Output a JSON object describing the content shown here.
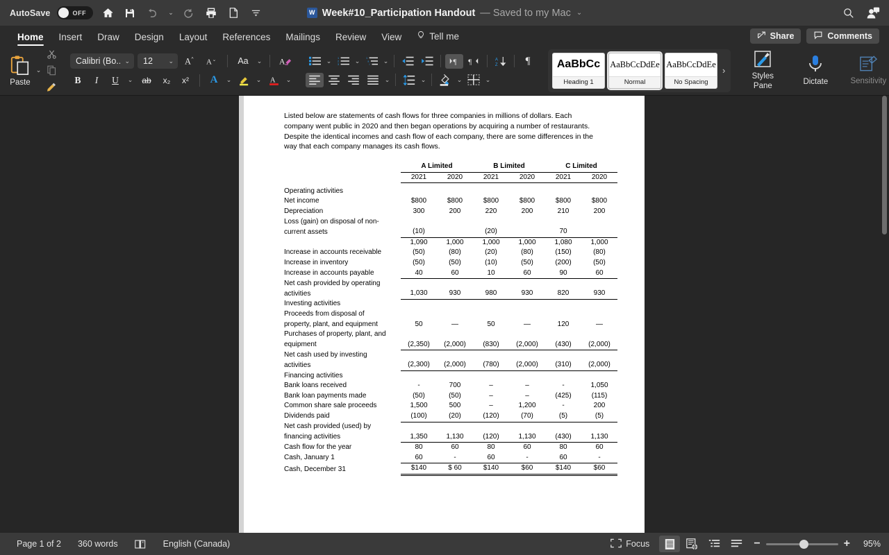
{
  "titlebar": {
    "autosave_label": "AutoSave",
    "autosave_state": "OFF",
    "doc_title": "Week#10_Participation Handout",
    "saved_status": "— Saved to my Mac",
    "quick_access": [
      {
        "name": "home-icon",
        "label": "Home"
      },
      {
        "name": "save-icon",
        "label": "Save"
      },
      {
        "name": "undo-icon",
        "label": "Undo"
      },
      {
        "name": "redo-icon",
        "label": "Redo"
      },
      {
        "name": "print-icon",
        "label": "Print"
      },
      {
        "name": "new-document-icon",
        "label": "New"
      },
      {
        "name": "customize-toolbar-icon",
        "label": "Customize Toolbar"
      }
    ],
    "search_icon": "search-icon",
    "account_icon": "account-icon"
  },
  "tabs": [
    {
      "label": "Home",
      "active": true
    },
    {
      "label": "Insert",
      "active": false
    },
    {
      "label": "Draw",
      "active": false
    },
    {
      "label": "Design",
      "active": false
    },
    {
      "label": "Layout",
      "active": false
    },
    {
      "label": "References",
      "active": false
    },
    {
      "label": "Mailings",
      "active": false
    },
    {
      "label": "Review",
      "active": false
    },
    {
      "label": "View",
      "active": false
    }
  ],
  "tellme": {
    "label": "Tell me",
    "icon": "lightbulb-icon"
  },
  "share_button": {
    "label": "Share",
    "icon": "share-icon"
  },
  "comments_button": {
    "label": "Comments",
    "icon": "comment-icon"
  },
  "ribbon": {
    "clipboard": {
      "paste_label": "Paste",
      "cut_icon": "scissors-icon",
      "copy_icon": "copy-icon",
      "format_painter_icon": "format-painter-icon"
    },
    "font": {
      "font_name": "Calibri (Bo...",
      "font_size": "12",
      "grow_font": "A^",
      "shrink_font": "Av",
      "change_case": "Aa",
      "clear_formatting": "clear-formatting-icon",
      "bold": "B",
      "italic": "I",
      "underline": "U",
      "strikethrough": "ab",
      "subscript": "x₂",
      "superscript": "x²",
      "text_effects": "A",
      "highlight": "A",
      "font_color": "A"
    },
    "paragraph": {
      "bullets": "bullets-icon",
      "numbering": "numbering-icon",
      "multilevel": "multilevel-list-icon",
      "decrease_indent": "decrease-indent-icon",
      "increase_indent": "increase-indent-icon",
      "ltr": "left-to-right-icon",
      "rtl": "right-to-left-icon",
      "sort": "sort-icon",
      "show_marks": "paragraph-marks-icon",
      "align_left": "align-left-icon",
      "align_center": "align-center-icon",
      "align_right": "align-right-icon",
      "justify": "justify-icon",
      "line_spacing": "line-spacing-icon",
      "shading": "shading-icon",
      "borders": "borders-icon"
    },
    "styles": [
      {
        "preview": "AaBbCc",
        "name": "Heading 1",
        "selected": false
      },
      {
        "preview": "AaBbCcDdEе",
        "name": "Normal",
        "selected": true
      },
      {
        "preview": "AaBbCcDdEе",
        "name": "No Spacing",
        "selected": false
      }
    ],
    "styles_more": "›",
    "styles_pane": {
      "line1": "Styles",
      "line2": "Pane",
      "icon": "styles-pane-icon"
    },
    "dictate": {
      "label": "Dictate",
      "icon": "microphone-icon"
    },
    "sensitivity": {
      "label": "Sensitivity",
      "icon": "sensitivity-icon"
    }
  },
  "document": {
    "intro": "Listed below are statements of cash flows for three companies in millions of dollars.  Each company went public in 2020 and then began operations by acquiring a number of restaurants. Despite the identical incomes and cash flow of each company, there are some differences in the way that each company manages its cash flows.",
    "companies": [
      "A Limited",
      "B Limited",
      "C Limited"
    ],
    "years": [
      "2021",
      "2020",
      "2021",
      "2020",
      "2021",
      "2020"
    ],
    "rows": [
      {
        "label": "Operating activities",
        "indent": 0,
        "values": [
          "",
          "",
          "",
          "",
          "",
          ""
        ]
      },
      {
        "label": "Net income",
        "indent": 1,
        "values": [
          "$800",
          "$800",
          "$800",
          "$800",
          "$800",
          "$800"
        ]
      },
      {
        "label": "Depreciation",
        "indent": 1,
        "values": [
          "300",
          "200",
          "220",
          "200",
          "210",
          "200"
        ]
      },
      {
        "label": "Loss (gain) on disposal of non-",
        "indent": 1,
        "values": [
          "",
          "",
          "",
          "",
          "",
          ""
        ]
      },
      {
        "label": "current assets",
        "indent": 2,
        "values": [
          "(10)",
          "",
          "(20)",
          "",
          "70",
          ""
        ],
        "rule_below": true
      },
      {
        "label": "",
        "indent": 0,
        "values": [
          "1,090",
          "1,000",
          "1,000",
          "1,000",
          "1,080",
          "1,000"
        ]
      },
      {
        "label": "Increase in accounts receivable",
        "indent": 2,
        "values": [
          "(50)",
          "(80)",
          "(20)",
          "(80)",
          "(150)",
          "(80)"
        ]
      },
      {
        "label": "Increase in inventory",
        "indent": 2,
        "values": [
          "(50)",
          "(50)",
          "(10)",
          "(50)",
          "(200)",
          "(50)"
        ]
      },
      {
        "label": "Increase in accounts payable",
        "indent": 2,
        "values": [
          "40",
          "60",
          "10",
          "60",
          "90",
          "60"
        ],
        "rule_below": true
      },
      {
        "label": "Net cash provided by operating",
        "indent": 0,
        "values": [
          "",
          "",
          "",
          "",
          "",
          ""
        ]
      },
      {
        "label": "activities",
        "indent": 0,
        "values": [
          "1,030",
          "930",
          "980",
          "930",
          "820",
          "930"
        ],
        "rule_below": true
      },
      {
        "label": "Investing activities",
        "indent": 0,
        "values": [
          "",
          "",
          "",
          "",
          "",
          ""
        ]
      },
      {
        "label": "Proceeds from disposal of",
        "indent": 1,
        "values": [
          "",
          "",
          "",
          "",
          "",
          ""
        ]
      },
      {
        "label": "property, plant, and equipment",
        "indent": 1,
        "values": [
          "50",
          "—",
          "50",
          "—",
          "120",
          "—"
        ]
      },
      {
        "label": "Purchases of property, plant, and",
        "indent": 1,
        "values": [
          "",
          "",
          "",
          "",
          "",
          ""
        ]
      },
      {
        "label": "equipment",
        "indent": 1,
        "values": [
          "(2,350)",
          "(2,000)",
          "(830)",
          "(2,000)",
          "(430)",
          "(2,000)"
        ],
        "rule_below": true
      },
      {
        "label": "Net cash used by investing",
        "indent": 0,
        "values": [
          "",
          "",
          "",
          "",
          "",
          ""
        ]
      },
      {
        "label": "activities",
        "indent": 0,
        "values": [
          "(2,300)",
          "(2,000)",
          "(780)",
          "(2,000)",
          "(310)",
          "(2,000)"
        ],
        "rule_below": true
      },
      {
        "label": "Financing activities",
        "indent": 0,
        "values": [
          "",
          "",
          "",
          "",
          "",
          ""
        ]
      },
      {
        "label": "Bank loans received",
        "indent": 2,
        "values": [
          "-",
          "700",
          "–",
          "–",
          "-",
          "1,050"
        ]
      },
      {
        "label": "Bank loan payments made",
        "indent": 2,
        "values": [
          "(50)",
          "(50)",
          "–",
          "–",
          "(425)",
          "(115)"
        ]
      },
      {
        "label": "Common share sale proceeds",
        "indent": 2,
        "values": [
          "1,500",
          "500",
          "–",
          "1,200",
          "-",
          "200"
        ]
      },
      {
        "label": "Dividends paid",
        "indent": 2,
        "values": [
          "(100)",
          "(20)",
          "(120)",
          "(70)",
          "(5)",
          "(5)"
        ],
        "rule_below": true
      },
      {
        "label": "Net cash provided (used) by",
        "indent": 0,
        "values": [
          "",
          "",
          "",
          "",
          "",
          ""
        ]
      },
      {
        "label": "financing activities",
        "indent": 0,
        "values": [
          "1,350",
          "1,130",
          "(120)",
          "1,130",
          "(430)",
          "1,130"
        ],
        "rule_below": true
      },
      {
        "label": "Cash flow for the year",
        "indent": 0,
        "values": [
          "80",
          "60",
          "80",
          "60",
          "80",
          "60"
        ]
      },
      {
        "label": "Cash, January 1",
        "indent": 0,
        "values": [
          "60",
          "-",
          "60",
          "-",
          "60",
          "-"
        ],
        "rule_below": true
      },
      {
        "label": "Cash, December 31",
        "indent": 0,
        "values": [
          "$140",
          "$ 60",
          "$140",
          "$60",
          "$140",
          "$60"
        ],
        "double_below": true
      }
    ]
  },
  "statusbar": {
    "page": "Page 1 of 2",
    "words": "360 words",
    "proofing_icon": "proofing-errors-icon",
    "language": "English (Canada)",
    "focus": {
      "label": "Focus",
      "icon": "focus-icon"
    },
    "views": [
      {
        "name": "print-layout-view",
        "active": true
      },
      {
        "name": "web-layout-view",
        "active": false
      },
      {
        "name": "outline-view",
        "active": false
      },
      {
        "name": "draft-view",
        "active": false
      }
    ],
    "zoom_out": "−",
    "zoom_in": "+",
    "zoom_level": "95%"
  },
  "colors": {
    "chrome": "#2b2b2b",
    "titlebar": "#3a3a3a",
    "accent_blue": "#2b579a",
    "page": "#ffffff",
    "icon_blue": "#2b9ae8"
  }
}
